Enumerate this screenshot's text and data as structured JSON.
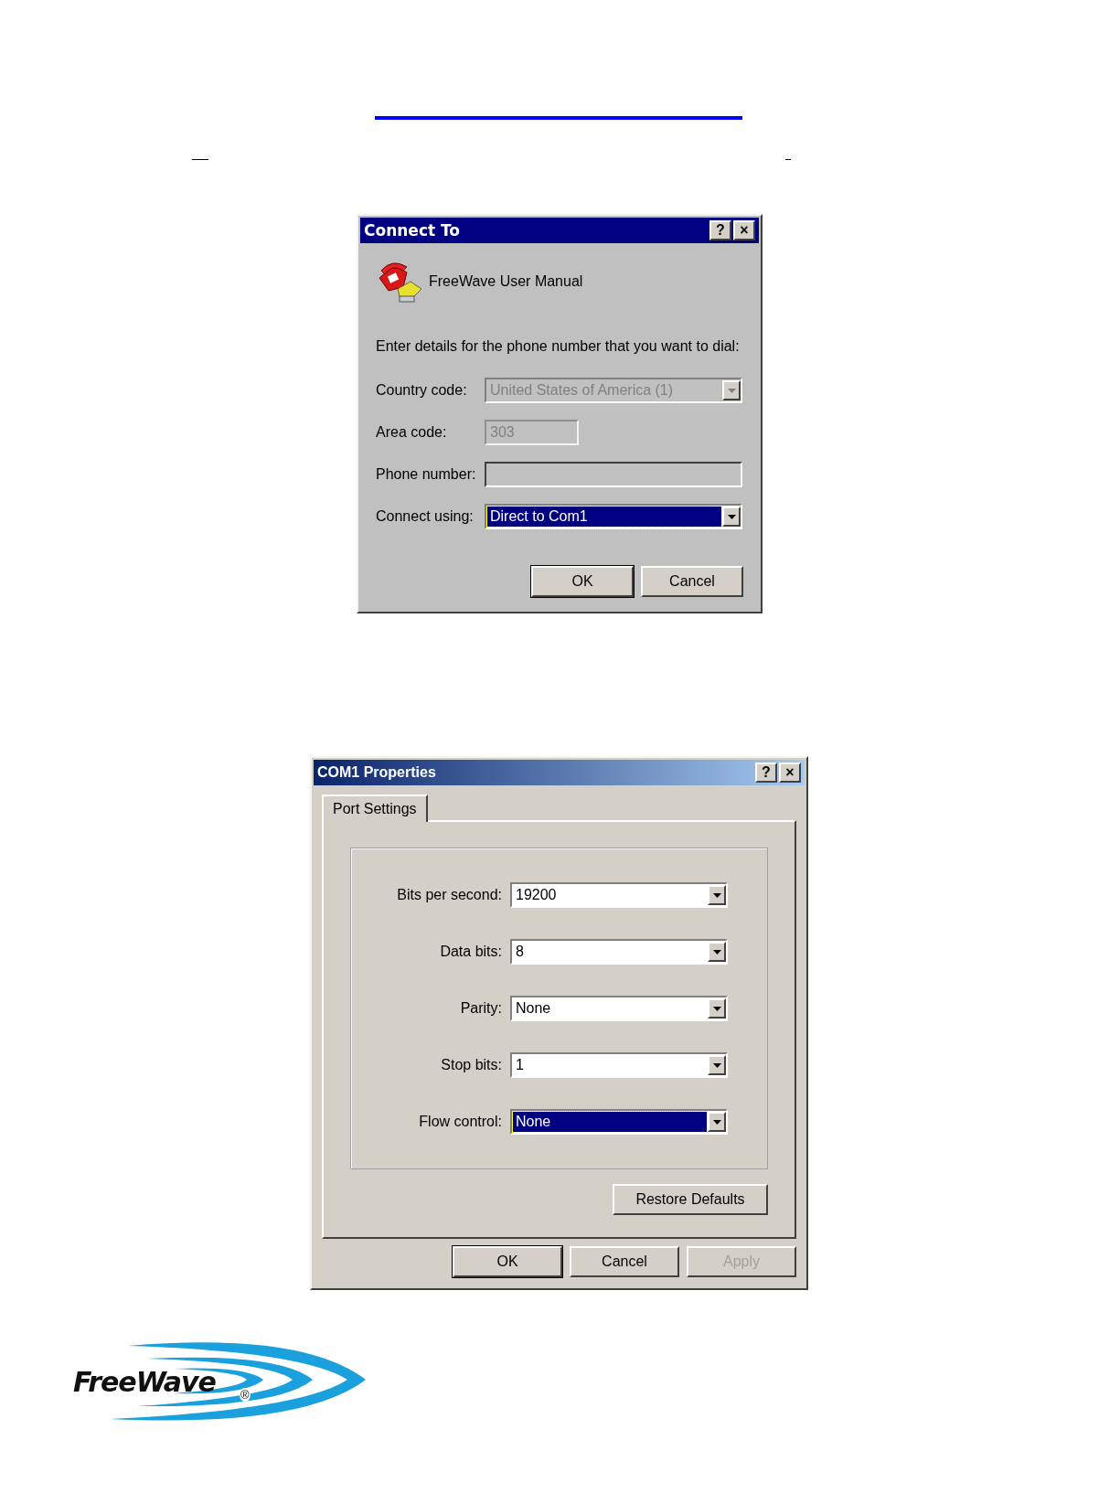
{
  "connect_dialog": {
    "title": "Connect To",
    "title_buttons": [
      "?",
      "×"
    ],
    "connection_name": "FreeWave User Manual",
    "prompt": "Enter details for the phone number that you want to dial:",
    "fields": [
      {
        "kind": "dropdown",
        "label": "Country code:",
        "value": "United States of America (1)",
        "disabled": true,
        "selected": false
      },
      {
        "kind": "text",
        "label": "Area code:",
        "value": "303",
        "disabled": true,
        "selected": false
      },
      {
        "kind": "text",
        "label": "Phone number:",
        "disabled": false,
        "selected": false
      },
      {
        "kind": "dropdown",
        "label": "Connect using:",
        "value": "Direct to Com1",
        "disabled": false,
        "selected": true
      }
    ],
    "buttons": [
      {
        "label": "OK",
        "default": true,
        "disabled": false
      },
      {
        "label": "Cancel",
        "default": false,
        "disabled": false
      }
    ]
  },
  "properties_dialog": {
    "title": "COM1 Properties",
    "title_buttons": [
      "?",
      "×"
    ],
    "tabs": [
      {
        "label": "Port Settings",
        "selected": true
      }
    ],
    "fields": [
      {
        "label": "Bits per second:",
        "value": "19200",
        "selected": false
      },
      {
        "label": "Data bits:",
        "value": "8",
        "selected": false
      },
      {
        "label": "Parity:",
        "value": "None",
        "selected": false
      },
      {
        "label": "Stop bits:",
        "value": "1",
        "selected": false
      },
      {
        "label": "Flow control:",
        "value": "None",
        "selected": true
      }
    ],
    "restore_button": "Restore Defaults",
    "buttons": [
      {
        "label": "OK",
        "default": true,
        "disabled": false
      },
      {
        "label": "Cancel",
        "default": false,
        "disabled": false
      },
      {
        "label": "Apply",
        "default": false,
        "disabled": true
      }
    ]
  },
  "logo": {
    "name": "FreeWave",
    "mark": "®"
  }
}
